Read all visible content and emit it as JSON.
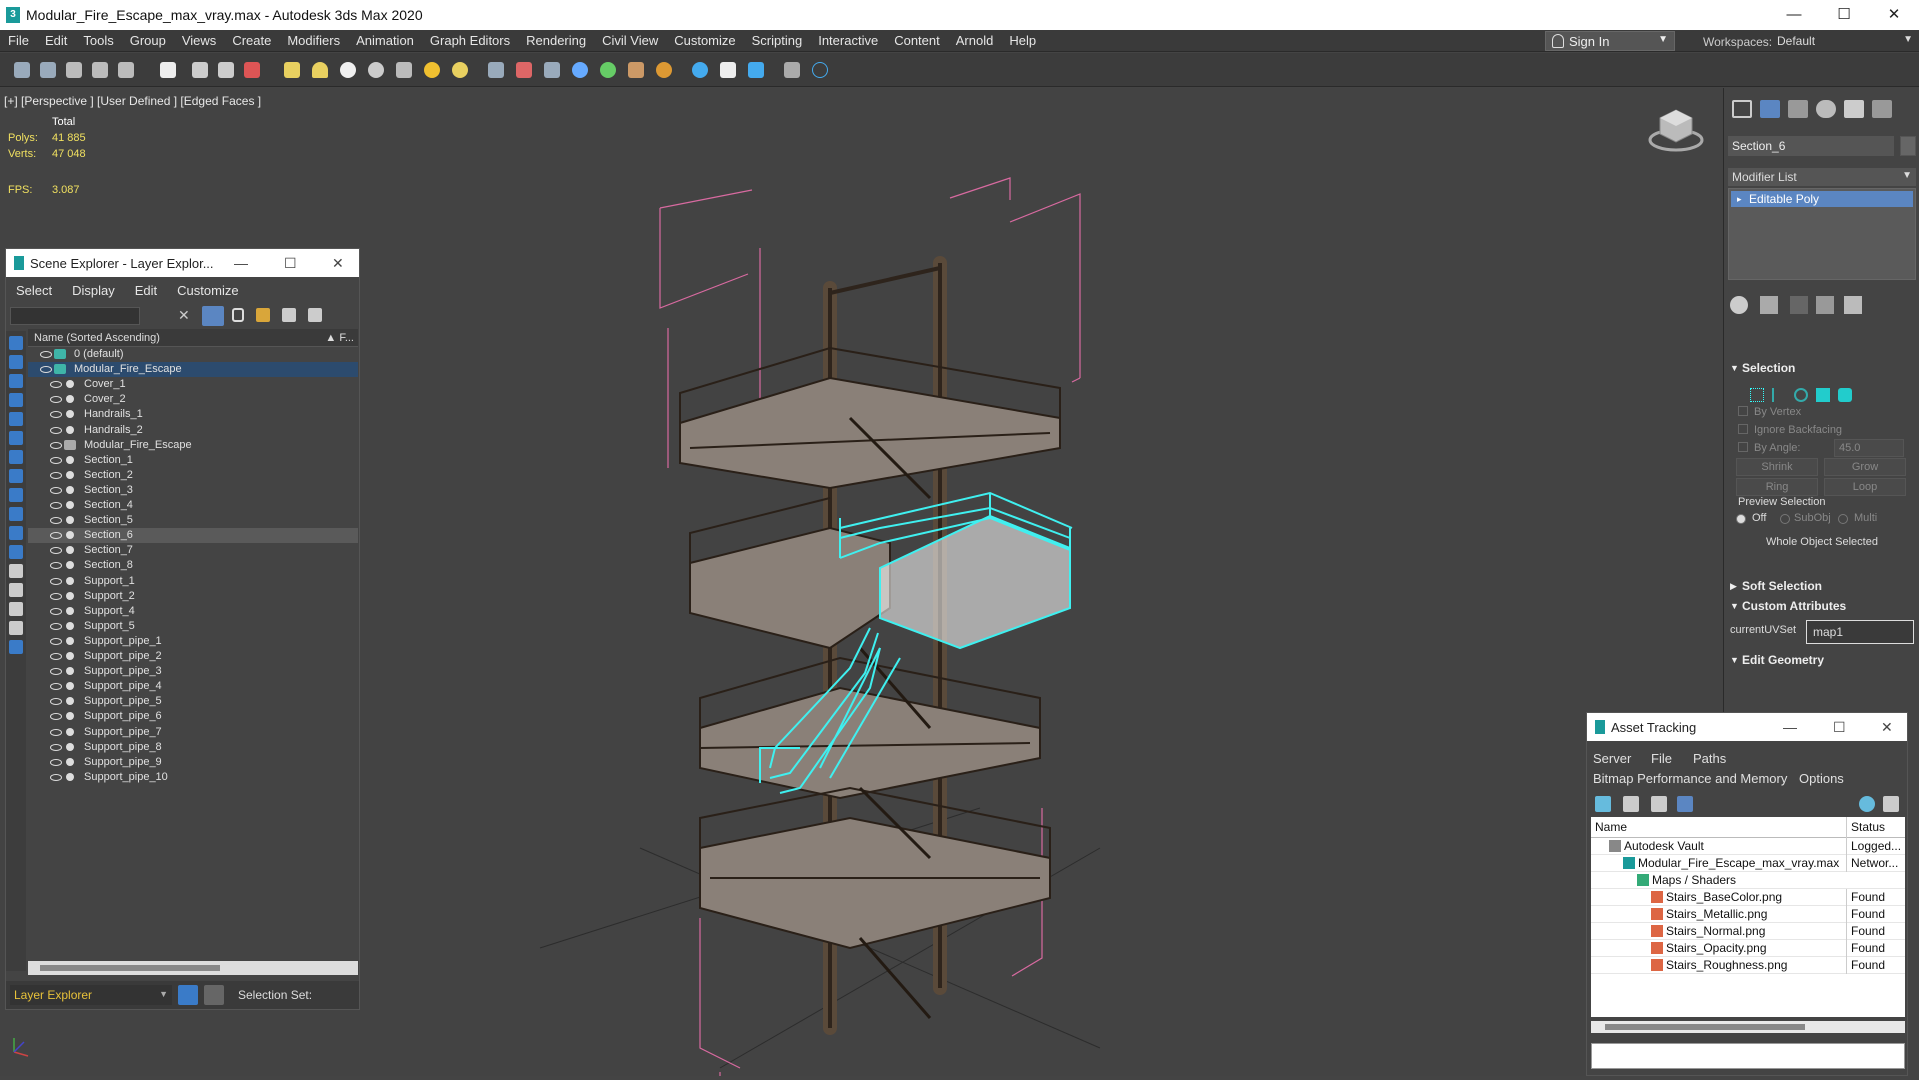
{
  "window": {
    "title": "Modular_Fire_Escape_max_vray.max - Autodesk 3ds Max 2020",
    "app_icon_glyph": "3",
    "minimize": "—",
    "maximize": "☐",
    "close": "✕"
  },
  "menubar": {
    "items": [
      "File",
      "Edit",
      "Tools",
      "Group",
      "Views",
      "Create",
      "Modifiers",
      "Animation",
      "Graph Editors",
      "Rendering",
      "Civil View",
      "Customize",
      "Scripting",
      "Interactive",
      "Content",
      "Arnold",
      "Help"
    ],
    "sign_in": "Sign In",
    "workspaces_label": "Workspaces:",
    "workspace_value": "Default",
    "dropdown_glyph": "▼"
  },
  "viewport": {
    "label": "[+] [Perspective ] [User Defined ] [Edged Faces ]",
    "stats": {
      "total_label": "Total",
      "polys_label": "Polys:",
      "polys_value": "41 885",
      "verts_label": "Verts:",
      "verts_value": "47 048",
      "fps_label": "FPS:",
      "fps_value": "3.087"
    }
  },
  "scene_explorer": {
    "title": "Scene Explorer - Layer Explor...",
    "menu": [
      "Select",
      "Display",
      "Edit",
      "Customize"
    ],
    "column_header": "Name (Sorted Ascending)",
    "column_right": "▲ F...",
    "rows": [
      {
        "label": "0 (default)",
        "kind": "layer"
      },
      {
        "label": "Modular_Fire_Escape",
        "kind": "layer-active"
      },
      {
        "label": "Cover_1",
        "kind": "obj"
      },
      {
        "label": "Cover_2",
        "kind": "obj"
      },
      {
        "label": "Handrails_1",
        "kind": "obj"
      },
      {
        "label": "Handrails_2",
        "kind": "obj"
      },
      {
        "label": "Modular_Fire_Escape",
        "kind": "group"
      },
      {
        "label": "Section_1",
        "kind": "obj"
      },
      {
        "label": "Section_2",
        "kind": "obj"
      },
      {
        "label": "Section_3",
        "kind": "obj"
      },
      {
        "label": "Section_4",
        "kind": "obj"
      },
      {
        "label": "Section_5",
        "kind": "obj"
      },
      {
        "label": "Section_6",
        "kind": "obj-selected"
      },
      {
        "label": "Section_7",
        "kind": "obj"
      },
      {
        "label": "Section_8",
        "kind": "obj"
      },
      {
        "label": "Support_1",
        "kind": "obj"
      },
      {
        "label": "Support_2",
        "kind": "obj"
      },
      {
        "label": "Support_4",
        "kind": "obj"
      },
      {
        "label": "Support_5",
        "kind": "obj"
      },
      {
        "label": "Support_pipe_1",
        "kind": "obj"
      },
      {
        "label": "Support_pipe_2",
        "kind": "obj"
      },
      {
        "label": "Support_pipe_3",
        "kind": "obj"
      },
      {
        "label": "Support_pipe_4",
        "kind": "obj"
      },
      {
        "label": "Support_pipe_5",
        "kind": "obj"
      },
      {
        "label": "Support_pipe_6",
        "kind": "obj"
      },
      {
        "label": "Support_pipe_7",
        "kind": "obj"
      },
      {
        "label": "Support_pipe_8",
        "kind": "obj"
      },
      {
        "label": "Support_pipe_9",
        "kind": "obj"
      },
      {
        "label": "Support_pipe_10",
        "kind": "obj"
      }
    ],
    "footer_layer": "Layer Explorer",
    "footer_selset": "Selection Set:"
  },
  "command_panel": {
    "object_name": "Section_6",
    "modifier_list": "Modifier List",
    "stack_item": "Editable Poly",
    "selection_title": "Selection",
    "by_vertex": "By Vertex",
    "ignore_backfacing": "Ignore Backfacing",
    "by_angle": "By Angle:",
    "by_angle_value": "45.0",
    "shrink": "Shrink",
    "grow": "Grow",
    "ring": "Ring",
    "loop": "Loop",
    "preview_selection": "Preview Selection",
    "off": "Off",
    "subobj": "SubObj",
    "multi": "Multi",
    "whole_object": "Whole Object Selected",
    "soft_selection": "Soft Selection",
    "custom_attributes": "Custom Attributes",
    "current_uvset_label": "currentUVSet",
    "current_uvset_value": "map1",
    "edit_geometry": "Edit Geometry"
  },
  "asset_tracking": {
    "title": "Asset Tracking",
    "menu1": [
      "Server",
      "File",
      "Paths"
    ],
    "menu2": [
      "Bitmap Performance and Memory",
      "Options"
    ],
    "col_name": "Name",
    "col_status": "Status",
    "rows": [
      {
        "name": "Autodesk Vault",
        "status": "Logged...",
        "indent": 1,
        "icon": "vault"
      },
      {
        "name": "Modular_Fire_Escape_max_vray.max",
        "status": "Networ...",
        "indent": 2,
        "icon": "max"
      },
      {
        "name": "Maps / Shaders",
        "status": "",
        "indent": 3,
        "icon": "folder"
      },
      {
        "name": "Stairs_BaseColor.png",
        "status": "Found",
        "indent": 4,
        "icon": "map"
      },
      {
        "name": "Stairs_Metallic.png",
        "status": "Found",
        "indent": 4,
        "icon": "map"
      },
      {
        "name": "Stairs_Normal.png",
        "status": "Found",
        "indent": 4,
        "icon": "map"
      },
      {
        "name": "Stairs_Opacity.png",
        "status": "Found",
        "indent": 4,
        "icon": "map"
      },
      {
        "name": "Stairs_Roughness.png",
        "status": "Found",
        "indent": 4,
        "icon": "map"
      }
    ]
  },
  "colors": {
    "selection_cyan": "#3ff0f0",
    "bbox_pink": "#d86aa0",
    "stat_yellow": "#f0e060",
    "accent_blue": "#5b86c2"
  }
}
